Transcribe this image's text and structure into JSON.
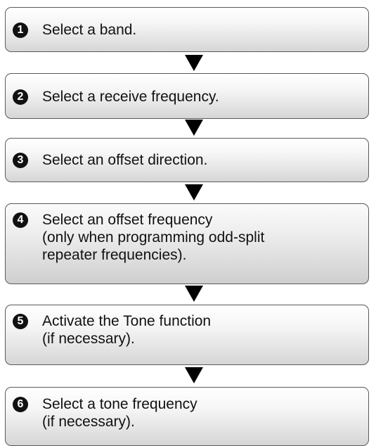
{
  "steps": [
    {
      "number": "1",
      "text": "Select a band."
    },
    {
      "number": "2",
      "text": "Select a receive frequency."
    },
    {
      "number": "3",
      "text": "Select an offset direction."
    },
    {
      "number": "4",
      "text": "Select an offset frequency\n(only when programming odd-split\nrepeater frequencies)."
    },
    {
      "number": "5",
      "text": "Activate the Tone function\n(if necessary)."
    },
    {
      "number": "6",
      "text": "Select a tone frequency\n(if necessary)."
    }
  ],
  "colors": {
    "border": "#5a5a5a",
    "text": "#111111",
    "arrow": "#000000",
    "badge": "#111111"
  }
}
